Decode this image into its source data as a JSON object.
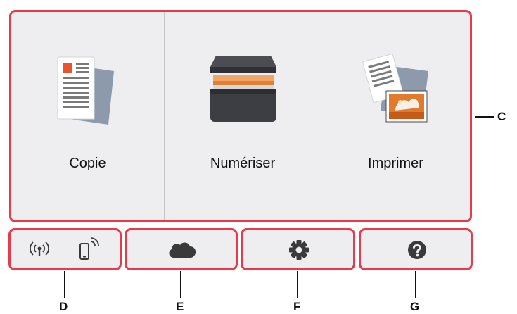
{
  "main_menu": {
    "copy_label": "Copie",
    "scan_label": "Numériser",
    "print_label": "Imprimer"
  },
  "bottom_bar": {
    "wireless_icon": "wireless-antenna-icon",
    "direct_icon": "phone-wireless-icon",
    "cloud_icon": "cloud-icon",
    "settings_icon": "gear-icon",
    "help_icon": "question-icon"
  },
  "callouts": {
    "c": "C",
    "d": "D",
    "e": "E",
    "f": "F",
    "g": "G"
  },
  "colors": {
    "highlight": "#e83a4b",
    "panel": "#eeedf0",
    "icon": "#3a3a3a"
  }
}
